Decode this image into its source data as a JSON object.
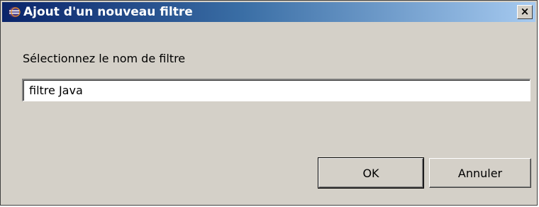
{
  "dialog": {
    "title": "Ajout d'un nouveau filtre",
    "close_label": "×",
    "prompt_label": "Sélectionnez le nom de filtre",
    "filter_name_value": "filtre Java",
    "buttons": {
      "ok_label": "OK",
      "cancel_label": "Annuler"
    }
  },
  "colors": {
    "titlebar_start": "#0a246a",
    "titlebar_end": "#a6caf0",
    "dialog_background": "#d4d0c8"
  },
  "icons": {
    "title_icon": "eclipse-icon",
    "close_icon": "close-icon"
  }
}
